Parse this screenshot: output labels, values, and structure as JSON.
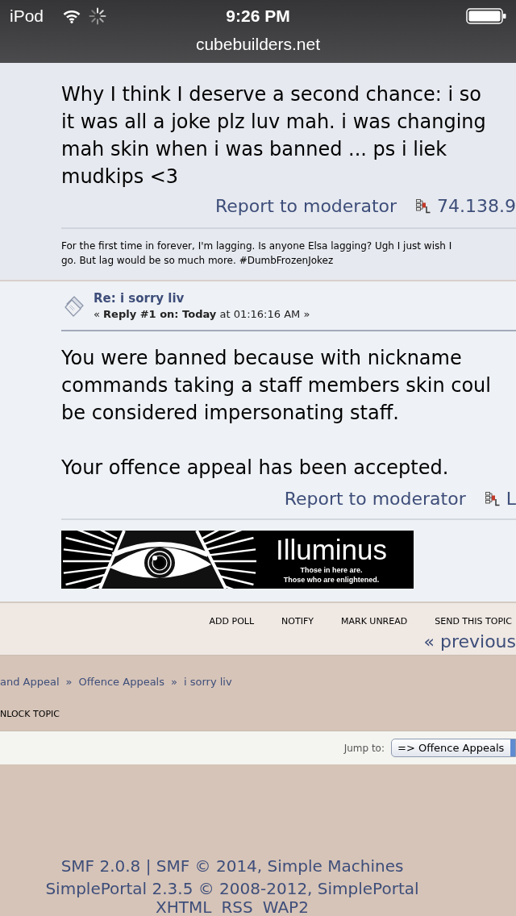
{
  "status_bar": {
    "device": "iPod",
    "time": "9:26 PM"
  },
  "address_bar": {
    "url": "cubebuilders.net"
  },
  "posts": [
    {
      "body": [
        [
          "Why I think I deserve a second chance: i so",
          "it was all a joke plz luv mah. i was changing",
          "mah skin when i was banned ... ps i liek",
          "mudkips <3"
        ]
      ],
      "report_link": "Report to moderator",
      "ip": "74.138.9",
      "signature": [
        "For the first time in forever, I'm lagging. Is anyone Elsa lagging? Ugh I just wish I",
        "go. But lag would be so much more. #DumbFrozenJokez"
      ]
    },
    {
      "subject": "Re: i sorry liv",
      "reply_info": "« **Reply #1 on: Today** at 01:16:16 AM »",
      "body": [
        [
          "You were banned because with nickname",
          "commands taking a staff members skin coul",
          "be considered impersonating staff."
        ],
        [
          "Your offence appeal has been accepted."
        ]
      ],
      "report_link": "Report to moderator",
      "ip": "L",
      "signature_banner": {
        "title": "Illuminus",
        "lines": [
          "Those in here are.",
          "Those who are enlightened."
        ]
      }
    }
  ],
  "topic_buttons": [
    "ADD POLL",
    "NOTIFY",
    "MARK UNREAD",
    "SEND THIS TOPIC"
  ],
  "pagination": {
    "previous": "« previous"
  },
  "breadcrumb": {
    "separator": "»",
    "items": [
      "and Appeal",
      "Offence Appeals",
      "i sorry liv"
    ]
  },
  "moderation_buttons": [
    "NLOCK TOPIC"
  ],
  "jump_to": {
    "label": "Jump to:",
    "value": "=> Offence Appeals"
  },
  "footer": {
    "lines": [
      "SMF 2.0.8 | SMF © 2014, Simple Machines",
      "SimplePortal 2.3.5 © 2008-2012, SimplePortal"
    ],
    "links": [
      "XHTML",
      "RSS",
      "WAP2"
    ]
  }
}
